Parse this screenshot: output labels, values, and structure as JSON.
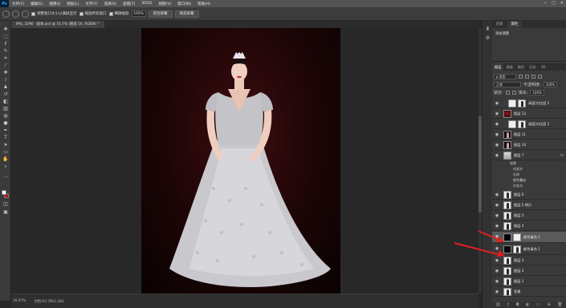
{
  "app": {
    "logo": "Ps",
    "menus": [
      "文件(F)",
      "编辑(E)",
      "图像(I)",
      "图层(L)",
      "文字(Y)",
      "选择(S)",
      "滤镜(T)",
      "3D(D)",
      "视图(V)",
      "窗口(W)",
      "帮助(H)"
    ]
  },
  "options": {
    "check1_label": "调整窗口大小以满屏显示",
    "check2_label": "缩放所有窗口",
    "check3_label": "细微缩放",
    "zoom_value": "100%",
    "fit_label": "适合屏幕",
    "fill_label": "填充屏幕"
  },
  "document": {
    "tab_label": "IMG_3296 - 副本.psd @ 16.7% (图层 16, RGB/8) *"
  },
  "status": {
    "zoom": "16.67%",
    "doc_info": "文档:93.7M/3.28G"
  },
  "right_panel": {
    "top_tabs": [
      "历史",
      "属性"
    ],
    "note": "添加调整",
    "layer_tabs": [
      "图层",
      "通道",
      "路径",
      "历史",
      "3D"
    ],
    "kind_filter": "ρ 类型",
    "blend_mode": "正常",
    "opacity_label": "不透明度:",
    "opacity_value": "100%",
    "lock_label": "锁定:",
    "fill_label": "填充:",
    "fill_value": "100%"
  },
  "layers": [
    {
      "name": "高度/对比度 2",
      "thumb": "white",
      "mask": "fig",
      "selected": false
    },
    {
      "name": "图层 13",
      "thumb": "dark-red",
      "mask": "",
      "selected": false
    },
    {
      "name": "高度/对比度 1",
      "thumb": "white",
      "mask": "fig",
      "selected": false
    },
    {
      "name": "图层 11",
      "thumb": "figdark",
      "mask": "",
      "selected": false
    },
    {
      "name": "图层 10",
      "thumb": "figdark",
      "mask": "",
      "selected": false
    },
    {
      "name": "图层 7",
      "thumb": "gray",
      "mask": "",
      "selected": false,
      "fx": "fx"
    },
    {
      "name": "图层 6",
      "thumb": "fig",
      "mask": "",
      "selected": false
    },
    {
      "name": "图层 5 拷贝",
      "thumb": "fig",
      "mask": "",
      "selected": false
    },
    {
      "name": "图层 5",
      "thumb": "fig",
      "mask": "",
      "selected": false
    },
    {
      "name": "图层 4",
      "thumb": "fig",
      "mask": "",
      "selected": false
    },
    {
      "name": "颜色填充 2",
      "thumb": "black",
      "mask": "white",
      "selected": true
    },
    {
      "name": "颜色填充 1",
      "thumb": "black",
      "mask": "fig",
      "selected": false
    },
    {
      "name": "图层 3",
      "thumb": "fig",
      "mask": "",
      "selected": false
    },
    {
      "name": "图层 2",
      "thumb": "fig",
      "mask": "",
      "selected": false
    },
    {
      "name": "图层 1",
      "thumb": "fig",
      "mask": "",
      "selected": false
    },
    {
      "name": "背景",
      "thumb": "fig",
      "mask": "",
      "selected": false
    }
  ],
  "effects": {
    "header": "效果",
    "items": [
      "内发光",
      "光泽",
      "颜色叠加",
      "外发光"
    ]
  },
  "colors": {
    "arrow": "#e02020",
    "background_red": "#3e0d10",
    "fg_swatch": "#ffffff",
    "bg_swatch": "#c01010"
  }
}
